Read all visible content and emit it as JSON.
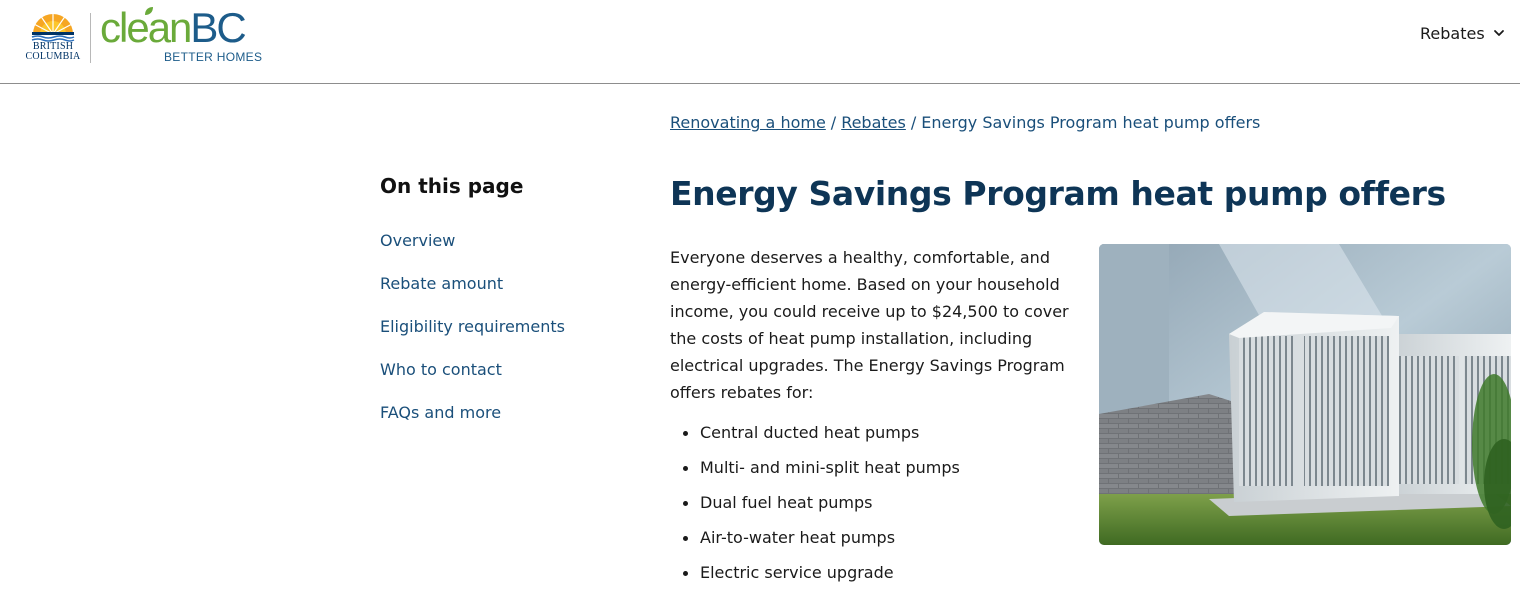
{
  "header": {
    "bc_logo_text_line1": "BRITISH",
    "bc_logo_text_line2": "COLUMBIA",
    "cleanbc_part1": "clean",
    "cleanbc_part2": "BC",
    "better_homes": "BETTER HOMES",
    "nav_label": "Rebates",
    "nav_icon": "chevron-down-icon"
  },
  "breadcrumb": {
    "items": [
      "Renovating a home",
      "Rebates"
    ],
    "separator": "/",
    "current": "Energy Savings Program heat pump offers"
  },
  "sidebar": {
    "title": "On this page",
    "items": [
      "Overview",
      "Rebate amount",
      "Eligibility requirements",
      "Who to contact",
      "FAQs and more"
    ]
  },
  "main": {
    "title": "Energy Savings Program heat pump offers",
    "intro": "Everyone deserves a healthy, comfortable, and energy-efficient home. Based on your household income, you could receive up to $24,500 to cover the costs of heat pump installation, including electrical upgrades. The Energy Savings Program offers rebates for:",
    "bullets": [
      "Central ducted heat pumps",
      "Multi- and mini-split heat pumps",
      "Dual fuel heat pumps",
      "Air-to-water heat pumps",
      "Electric service upgrade"
    ]
  },
  "colors": {
    "link": "#1a4f7a",
    "title": "#0e3556",
    "clean_green": "#6aaa3a",
    "bc_blue": "#1d5c8a"
  }
}
